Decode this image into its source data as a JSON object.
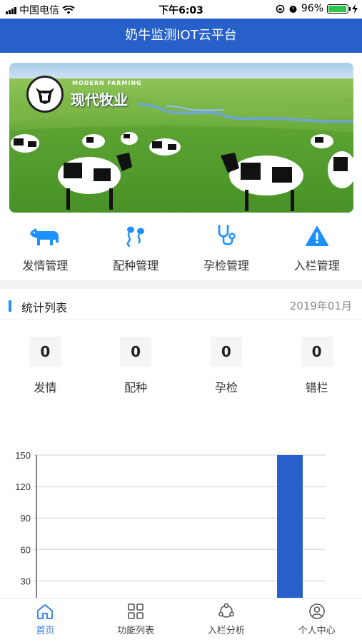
{
  "status_bar": {
    "carrier": "中国电信",
    "time": "下午6:03",
    "battery": "96%",
    "battery_level": 0.96
  },
  "navbar": {
    "title": "奶牛监测IOT云平台"
  },
  "banner": {
    "logo_en": "MODERN FARMING",
    "logo_cn": "现代牧业"
  },
  "shortcuts": [
    {
      "label": "发情管理",
      "icon": "cow-icon"
    },
    {
      "label": "配种管理",
      "icon": "sperm-icon"
    },
    {
      "label": "孕检管理",
      "icon": "stethoscope-icon"
    },
    {
      "label": "入栏管理",
      "icon": "warning-icon"
    }
  ],
  "stats_section": {
    "title": "统计列表",
    "date": "2019年01月",
    "items": [
      {
        "label": "发情",
        "value": "0"
      },
      {
        "label": "配种",
        "value": "0"
      },
      {
        "label": "孕检",
        "value": "0"
      },
      {
        "label": "错栏",
        "value": "0"
      }
    ]
  },
  "chart_data": {
    "type": "bar",
    "y_ticks": [
      "150",
      "120",
      "90",
      "60",
      "30"
    ],
    "ylim": [
      0,
      150
    ],
    "values": [
      0,
      0,
      0,
      150
    ],
    "bar_color": "#2660c8"
  },
  "tabbar": [
    {
      "label": "首页",
      "icon": "home-icon",
      "active": true
    },
    {
      "label": "功能列表",
      "icon": "grid-icon",
      "active": false
    },
    {
      "label": "入栏分析",
      "icon": "share-icon",
      "active": false
    },
    {
      "label": "个人中心",
      "icon": "user-icon",
      "active": false
    }
  ],
  "colors": {
    "brand": "#2660c8",
    "accent": "#1e90ff",
    "active_tab": "#2a7de1"
  }
}
